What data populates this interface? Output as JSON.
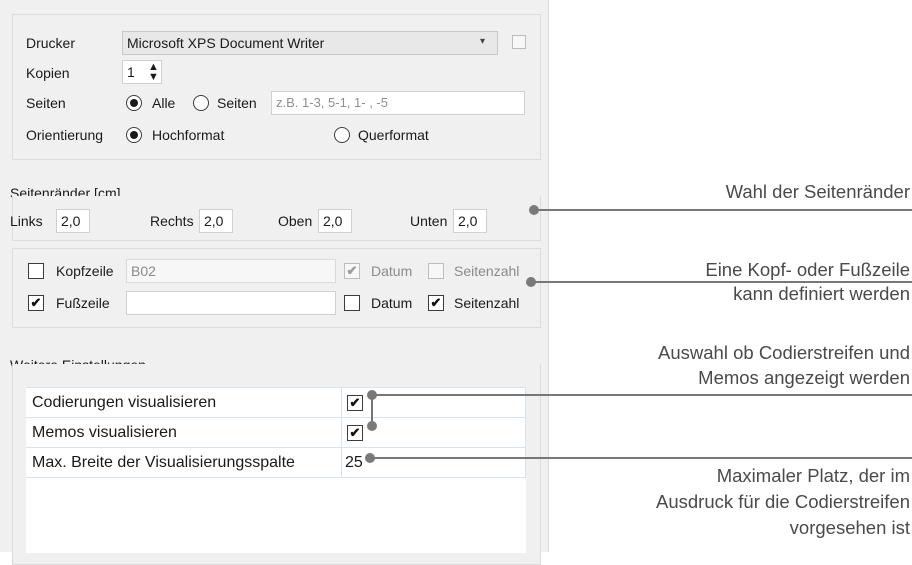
{
  "printer": {
    "label": "Drucker",
    "value": "Microsoft XPS Document Writer"
  },
  "copies": {
    "label": "Kopien",
    "value": "1"
  },
  "pages": {
    "label": "Seiten",
    "all_label": "Alle",
    "pages_label": "Seiten",
    "placeholder": "z.B. 1-3, 5-1, 1- , -5"
  },
  "orientation": {
    "label": "Orientierung",
    "portrait": "Hochformat",
    "landscape": "Querformat"
  },
  "margins": {
    "title": "Seitenränder [cm]",
    "left_label": "Links",
    "left": "2,0",
    "right_label": "Rechts",
    "right": "2,0",
    "top_label": "Oben",
    "top": "2,0",
    "bottom_label": "Unten",
    "bottom": "2,0"
  },
  "header": {
    "label": "Kopfzeile",
    "value": "B02",
    "date_label": "Datum",
    "pagenum_label": "Seitenzahl"
  },
  "footer": {
    "label": "Fußzeile",
    "value": "",
    "date_label": "Datum",
    "pagenum_label": "Seitenzahl"
  },
  "further": {
    "title": "Weitere Einstellungen",
    "rows": [
      {
        "label": "Codierungen visualisieren",
        "value": "✔"
      },
      {
        "label": "Memos visualisieren",
        "value": "✔"
      },
      {
        "label": "Max. Breite der Visualisierungsspalte",
        "value": "25"
      }
    ]
  },
  "callouts": {
    "c1": "Wahl der Seitenränder",
    "c2a": "Eine Kopf- oder Fußzeile",
    "c2b": "kann definiert werden",
    "c3a": "Auswahl ob Codierstreifen und",
    "c3b": "Memos angezeigt werden",
    "c4a": "Maximaler Platz, der im",
    "c4b": "Ausdruck für die Codierstreifen",
    "c4c": "vorgesehen ist"
  },
  "colors": {
    "panel": "#f0f0f0",
    "callout_line": "#777777",
    "table_grid": "#d6e4f0"
  }
}
